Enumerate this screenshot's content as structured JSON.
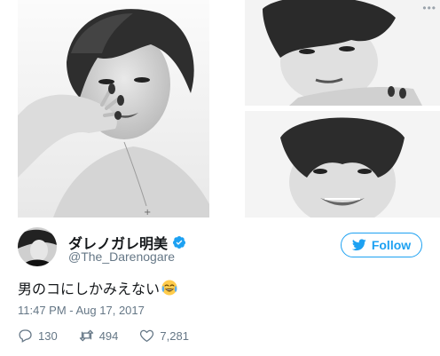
{
  "header": {
    "more_icon": "more-dots-icon",
    "more_text": "•••"
  },
  "media": {
    "photos": [
      {
        "name": "photo-left"
      },
      {
        "name": "photo-top-right"
      },
      {
        "name": "photo-bottom-right"
      }
    ]
  },
  "user": {
    "display_name": "ダレノガレ明美",
    "handle": "@The_Darenogare",
    "verified": true,
    "verified_icon": "verified-badge-icon"
  },
  "follow": {
    "label": "Follow",
    "icon": "twitter-bird-icon"
  },
  "tweet": {
    "text": "男のコにしかみえない",
    "emoji": "face-with-tears-of-joy",
    "timestamp": "11:47 PM - Aug 17, 2017"
  },
  "actions": {
    "reply": {
      "count": "130",
      "icon": "reply-icon"
    },
    "retweet": {
      "count": "494",
      "icon": "retweet-icon"
    },
    "like": {
      "count": "7,281",
      "icon": "heart-icon"
    }
  },
  "colors": {
    "accent": "#1da1f2",
    "secondary_text": "#657786",
    "primary_text": "#14171a"
  }
}
